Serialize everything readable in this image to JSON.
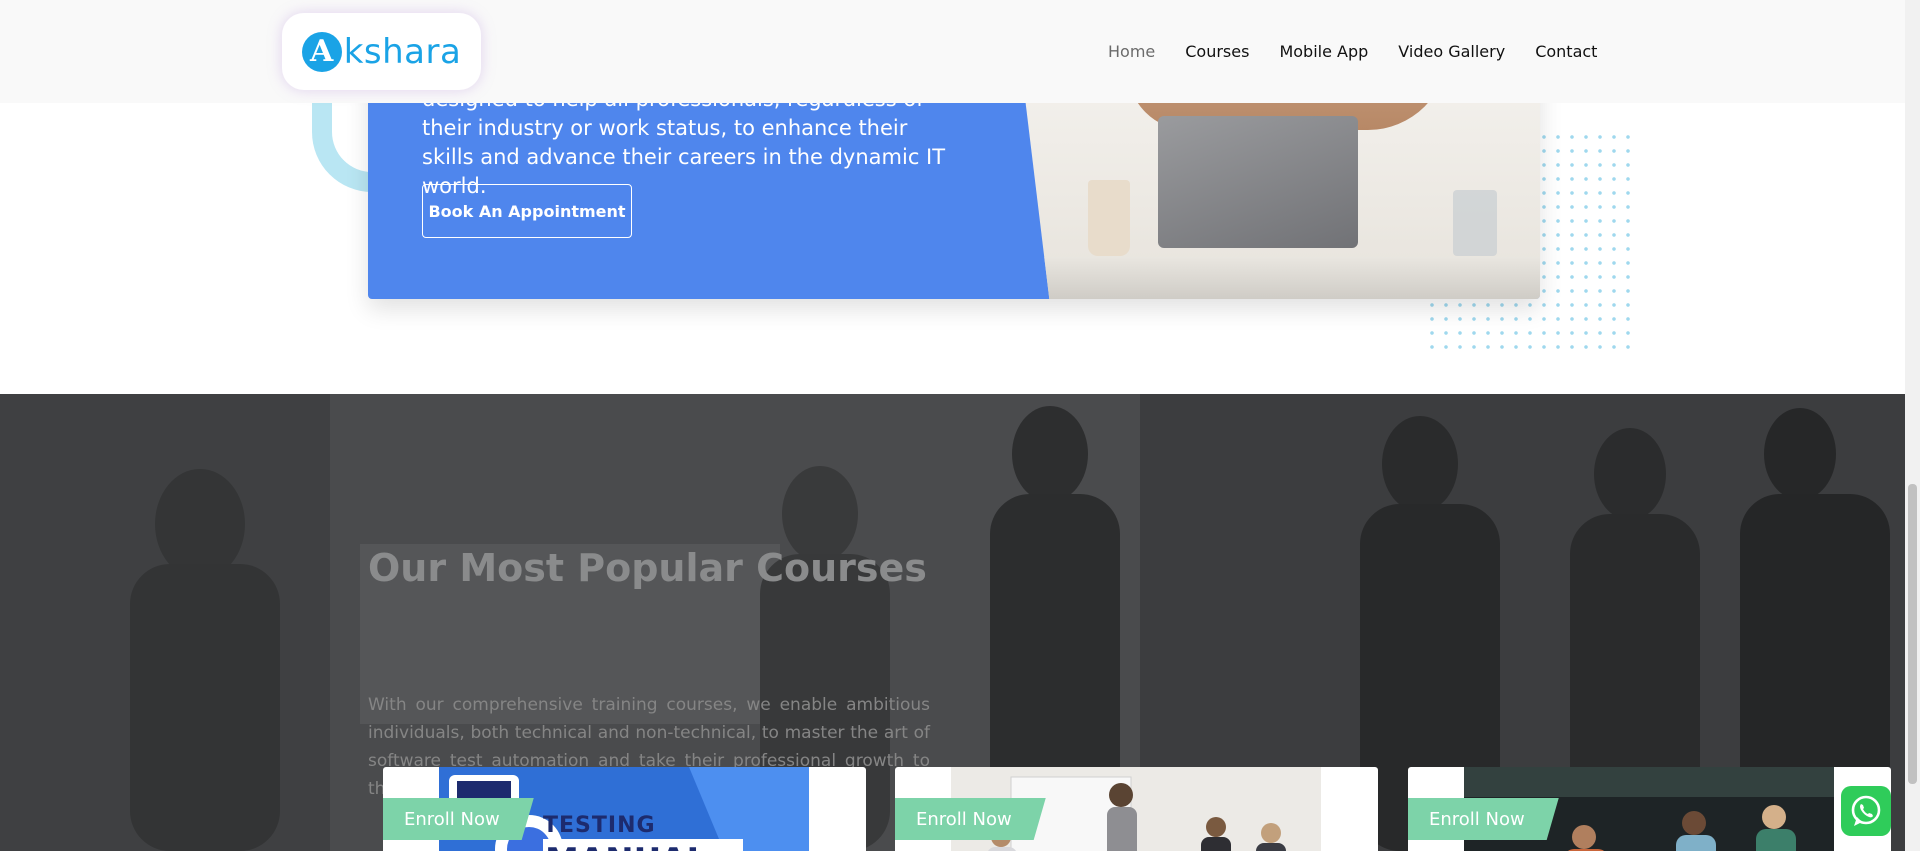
{
  "header": {
    "logo": {
      "mark": "A",
      "text": "kshara"
    },
    "nav": [
      {
        "label": "Home",
        "active": true
      },
      {
        "label": "Courses"
      },
      {
        "label": "Mobile App"
      },
      {
        "label": "Video Gallery"
      },
      {
        "label": "Contact"
      }
    ]
  },
  "hero": {
    "text": "designed to help all professionals, regardless of their industry or work status, to enhance their skills and advance their careers in the dynamic IT world.",
    "button_label": "Book An Appointment"
  },
  "courses": {
    "title": "Our Most Popular Courses",
    "description": "With our comprehensive training courses, we enable ambitious individuals, both technical and non-technical, to master the art of software test automation and take their professional growth to the ne",
    "cards": [
      {
        "badge": "Enroll Now",
        "image_text_1": "TESTING",
        "image_text_2": "MANUAL"
      },
      {
        "badge": "Enroll Now"
      },
      {
        "badge": "Enroll Now"
      }
    ]
  },
  "icons": {
    "whatsapp": "whatsapp-icon"
  },
  "colors": {
    "brand": "#1aa3e6",
    "hero_blue": "#4f86ed",
    "enroll_green": "#7dd3a9",
    "whatsapp_green": "#2fcc5a"
  }
}
